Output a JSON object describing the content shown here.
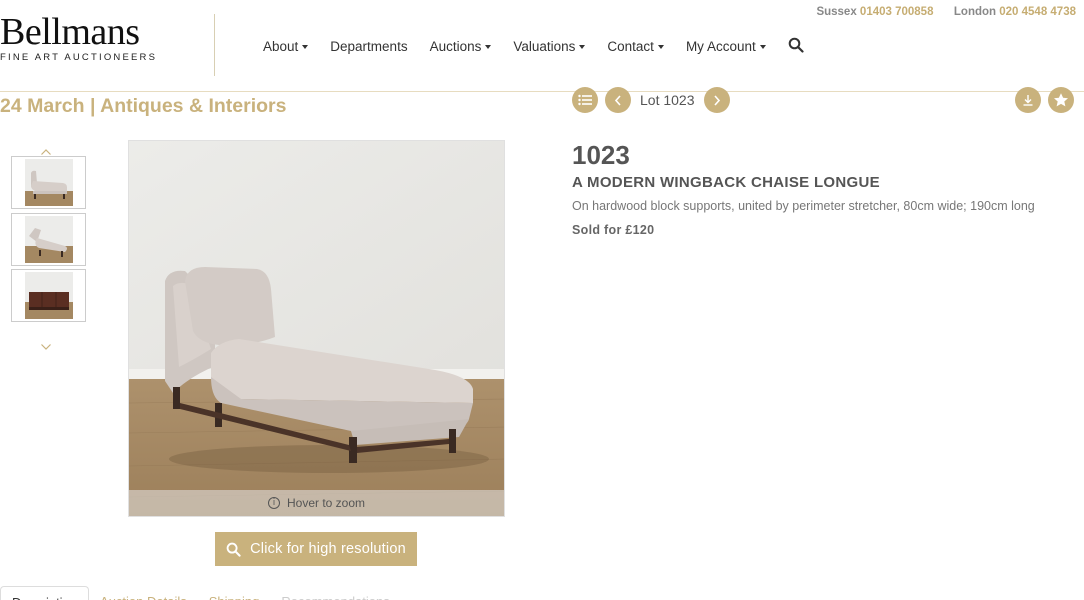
{
  "brand": {
    "name": "Bellmans",
    "tagline": "FINE ART AUCTIONEERS"
  },
  "contact": [
    {
      "label": "Sussex",
      "number": "01403 700858"
    },
    {
      "label": "London",
      "number": "020 4548 4738"
    }
  ],
  "nav": [
    {
      "label": "About",
      "dropdown": true
    },
    {
      "label": "Departments",
      "dropdown": false
    },
    {
      "label": "Auctions",
      "dropdown": true
    },
    {
      "label": "Valuations",
      "dropdown": true
    },
    {
      "label": "Contact",
      "dropdown": true
    },
    {
      "label": "My Account",
      "dropdown": true
    }
  ],
  "sale": {
    "title": "24 March | Antiques & Interiors"
  },
  "lot_nav": {
    "label": "Lot 1023"
  },
  "gallery": {
    "thumb_count": 3,
    "hover_text": "Hover to zoom",
    "hires_label": "Click for high resolution"
  },
  "lot": {
    "number": "1023",
    "title": "A MODERN WINGBACK CHAISE LONGUE",
    "description": "On hardwood block supports, united by perimeter stretcher, 80cm wide; 190cm long",
    "sold": "Sold for £120"
  },
  "tabs": [
    {
      "label": "Description",
      "state": "active"
    },
    {
      "label": "Auction Details",
      "state": "inactive"
    },
    {
      "label": "Shipping",
      "state": "inactive"
    },
    {
      "label": "Recommendations",
      "state": "muted"
    }
  ],
  "colors": {
    "accent": "#c9b27d",
    "contact_number": "#c6ad72"
  }
}
